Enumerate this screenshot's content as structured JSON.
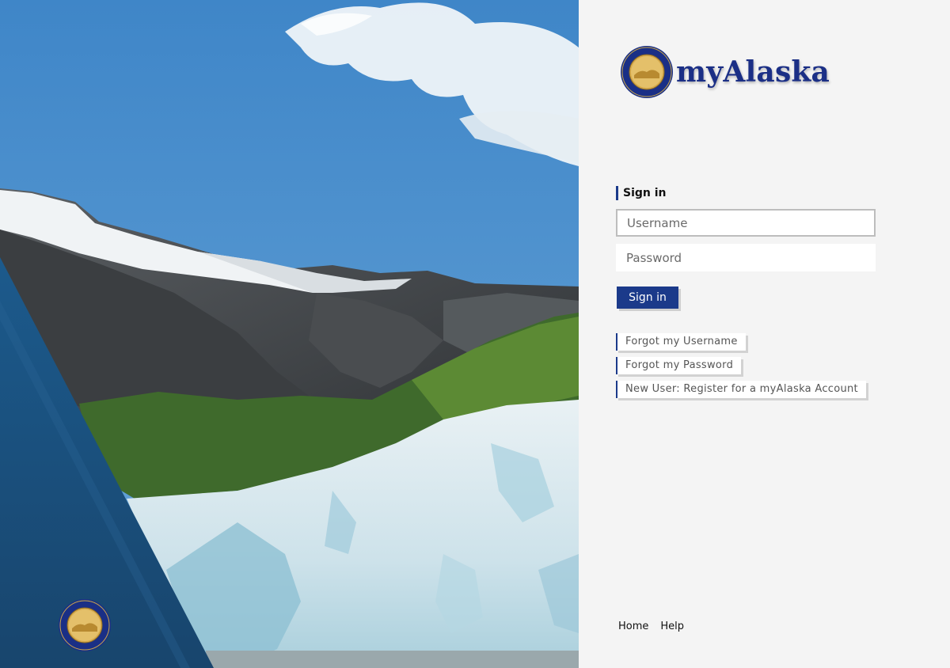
{
  "brand": {
    "name": "myAlaska",
    "seal_icon": "alaska-state-seal-icon",
    "color": "#1b2f86"
  },
  "signin": {
    "heading": "Sign in",
    "username_placeholder": "Username",
    "password_placeholder": "Password",
    "submit_label": "Sign in"
  },
  "help_links": {
    "forgot_username": "Forgot my Username",
    "forgot_password": "Forgot my Password",
    "register": "New User: Register for a myAlaska Account"
  },
  "footer": {
    "home": "Home",
    "help": "Help"
  },
  "colors": {
    "accent": "#1b3a8a",
    "panel_bg": "#f4f4f4",
    "overlay": "#1f4e78"
  }
}
